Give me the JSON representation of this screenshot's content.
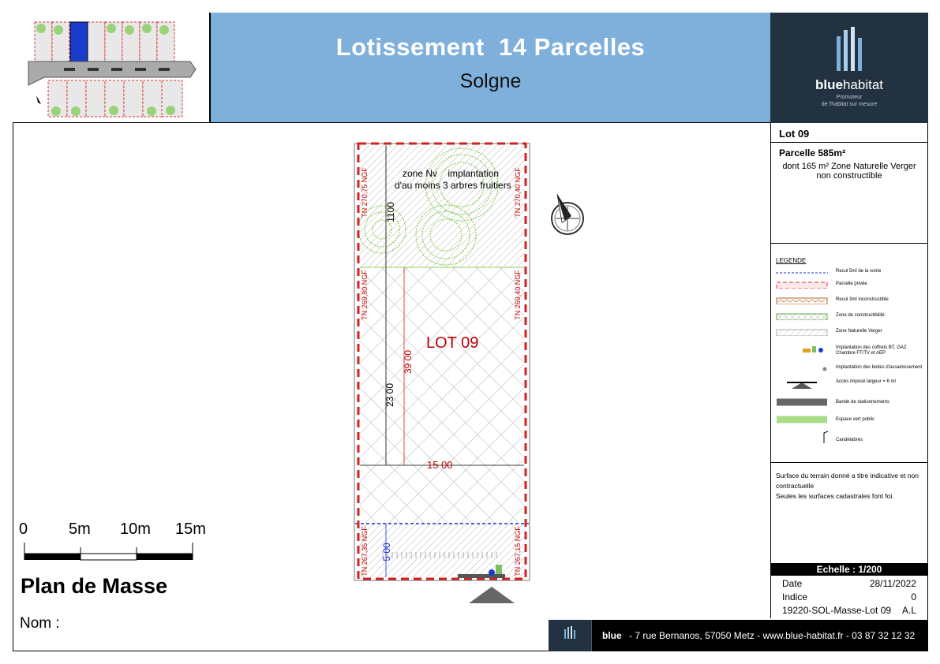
{
  "header": {
    "title": "Lotissement  14 Parcelles",
    "subtitle": "Solgne"
  },
  "logo": {
    "brand_bold": "blue",
    "brand_light": "habitat",
    "tagline_1": "Promoteur",
    "tagline_2": "de l'habitat sur mesure"
  },
  "lot": {
    "label": "Lot  09",
    "parcel_title": "Parcelle 585m²",
    "parcel_note_1": "dont 165 m² Zone Naturelle Verger",
    "parcel_note_2": "non constructible"
  },
  "legend": {
    "title": "LEGENDE",
    "items": [
      "Recul 5ml de la voirie",
      "Parcelle privée",
      "Recul 3ml inconstructible",
      "Zone de constructibilité",
      "Zone Naturelle Verger",
      "Implantation des coffrets BT, GAZ Chambre FT/TV et AEP",
      "Implantation des boites d'assainissement",
      "Accès imposé largeur = 6 ml",
      "Bande de stationnements",
      "Espace vert public",
      "Candélabres"
    ]
  },
  "note": {
    "line_1": "Surface du terrain donné a titre indicative et non contractuelle",
    "line_2": "Seules les surfaces cadastrales font foi."
  },
  "scale_header": "Echelle : 1/200",
  "meta": {
    "date_label": "Date",
    "date_value": "28/11/2022",
    "indice_label": "Indice",
    "indice_value": "0",
    "ref": "19220-SOL-Masse-Lot 09",
    "author": "A.L"
  },
  "footer": {
    "brand": "blue",
    "address": "- 7 rue Bernanos, 57050 Metz - www.blue-habitat.fr - 03 87 32 12 32"
  },
  "plan": {
    "lot_name": "LOT 09",
    "zone_note_1": "zone Nv    implantation",
    "zone_note_2": "d'au moins 3 arbres fruitiers",
    "tn_top_left": "TN 270,75 NGF",
    "tn_top_right": "TN 270,40 NGF",
    "tn_mid_left": "TN 269,80 NGF",
    "tn_mid_right": "TN 269,40 NGF",
    "tn_bot_left": "TN 267,35 NGF",
    "tn_bot_right": "TN 267,15 NGF",
    "dim_1100": "1100",
    "dim_2300": "23 00",
    "dim_3900": "39 00",
    "dim_1500": "15 00",
    "dim_500": "5 00"
  },
  "scale_bar": {
    "labels": [
      "0",
      "5m",
      "10m",
      "15m"
    ]
  },
  "plan_title": "Plan de Masse",
  "name_label": "Nom :",
  "colors": {
    "header_blue": "#7fb0dc",
    "logo_bg": "#233240",
    "lot_red": "#c00000",
    "green": "#8ccf5a"
  }
}
